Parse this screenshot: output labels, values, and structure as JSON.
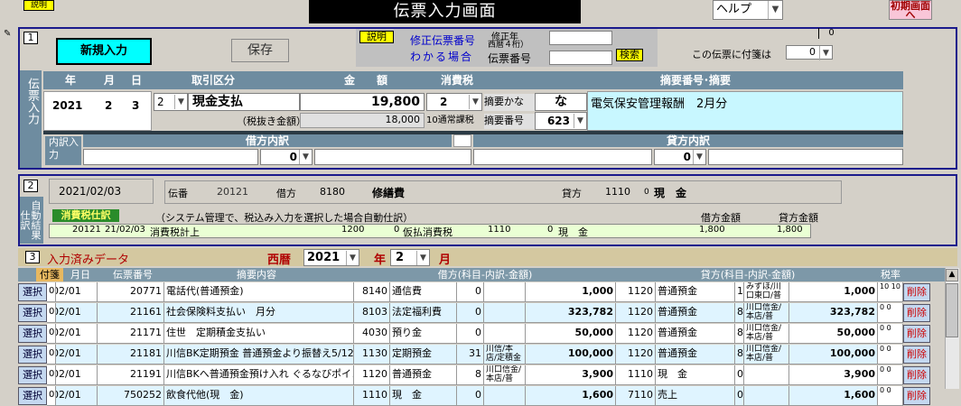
{
  "window": {
    "title": "伝票入力画面",
    "help_small": "説明",
    "help_combo": "ヘルプ",
    "init_button": "初期画面へ"
  },
  "section1": {
    "number": "1",
    "side_label": "伝票入力",
    "new_button": "新規入力",
    "save_button": "保存",
    "explain_button": "説明",
    "fix_label_line1": "修正伝票番号",
    "fix_label_line2": "わかる場合",
    "fix_year_label": "修正年",
    "fix_year_sub": "西暦４桁）",
    "slip_no_label": "伝票番号",
    "search_button": "検索",
    "tag_label": "この伝票に付箋は",
    "tag_value": "0",
    "top_right_value": "0",
    "headers": {
      "year": "年",
      "month": "月",
      "day": "日",
      "kind": "取引区分",
      "amount": "金　　額",
      "tax": "消費税",
      "memo": "摘要番号･摘要"
    },
    "entry": {
      "year": "2021",
      "month": "2",
      "day": "3",
      "kind_code": "2",
      "kind_name": "現金支払",
      "amount": "19,800",
      "tax_code": "2",
      "net_label": "（税抜き金額）",
      "net_amount": "18,000",
      "tax_type": "10通常課税",
      "kana_label": "摘要かな",
      "kana_value": "な",
      "memo_no_label": "摘要番号",
      "memo_no": "623",
      "memo_text": "電気保安管理報酬　2月分"
    },
    "breakdown_label": "内訳入力",
    "debit_label": "借方内訳",
    "credit_label": "貸方内訳",
    "debit_value": "0",
    "credit_value": "0"
  },
  "section2": {
    "number": "2",
    "side_label": "自動結果仕訳",
    "date": "2021/02/03",
    "slip_label": "伝番",
    "slip_no": "20121",
    "debit_label": "借方",
    "debit_code": "8180",
    "debit_name": "修繕費",
    "credit_label": "貸方",
    "credit_code": "1110",
    "credit_sub": "0",
    "credit_name": "現　金",
    "tax_title": "消費税仕訳",
    "tax_note": "（システム管理で、税込み入力を選択した場合自動仕訳）",
    "debit_amount_label": "借方金額",
    "credit_amount_label": "貸方金額",
    "tax_row": {
      "slip": "20121",
      "date": "21/02/03",
      "memo": "消費税計上",
      "dcode": "1200",
      "dsub": "0",
      "dname": "仮払消費税",
      "ccode": "1110",
      "csub": "0",
      "cname": "現　金",
      "damount": "1,800",
      "camount": "1,800"
    }
  },
  "section3": {
    "number": "3",
    "title": "入力済みデータ",
    "era_label": "西暦",
    "year": "2021",
    "year_label": "年",
    "month": "2",
    "month_label": "月",
    "columns": {
      "tag": "付箋",
      "date": "月日",
      "slip": "伝票番号",
      "memo": "摘要内容",
      "debit": "借方(科目-内訳-金額)",
      "credit": "貸方(科目-内訳-金額)",
      "rate": "税率"
    },
    "select_label": "選択",
    "delete_label": "削除",
    "rows": [
      {
        "tag": "0",
        "date": "02/01",
        "slip": "20771",
        "memo": "電話代(普通預金)",
        "dcode": "8140",
        "dname": "通信費",
        "dsub": "0",
        "dsubname": "",
        "damount": "1,000",
        "ccode": "1120",
        "cname": "普通預金",
        "csub": "1",
        "csubname": "みずほ/川口東口/普",
        "camount": "1,000",
        "r1": "10",
        "r2": "10"
      },
      {
        "tag": "0",
        "date": "02/01",
        "slip": "21161",
        "memo": "社会保険料支払い　月分",
        "dcode": "8103",
        "dname": "法定福利費",
        "dsub": "0",
        "dsubname": "",
        "damount": "323,782",
        "ccode": "1120",
        "cname": "普通預金",
        "csub": "8",
        "csubname": "川口信金/本店/普",
        "camount": "323,782",
        "r1": "0",
        "r2": "0"
      },
      {
        "tag": "0",
        "date": "02/01",
        "slip": "21171",
        "memo": "住世　定期積金支払い",
        "dcode": "4030",
        "dname": "預り金",
        "dsub": "0",
        "dsubname": "",
        "damount": "50,000",
        "ccode": "1120",
        "cname": "普通預金",
        "csub": "8",
        "csubname": "川口信金/本店/普",
        "camount": "50,000",
        "r1": "0",
        "r2": "0"
      },
      {
        "tag": "0",
        "date": "02/01",
        "slip": "21181",
        "memo": "川信BK定期預金 普通預金より振替え5/12",
        "dcode": "1130",
        "dname": "定期預金",
        "dsub": "31",
        "dsubname": "川信/本店/定積金",
        "damount": "100,000",
        "ccode": "1120",
        "cname": "普通預金",
        "csub": "8",
        "csubname": "川口信金/本店/普",
        "camount": "100,000",
        "r1": "0",
        "r2": "0"
      },
      {
        "tag": "0",
        "date": "02/01",
        "slip": "21191",
        "memo": "川信BKへ普通預金預け入れ ぐるなびポイント",
        "dcode": "1120",
        "dname": "普通預金",
        "dsub": "8",
        "dsubname": "川口信金/本店/普",
        "damount": "3,900",
        "ccode": "1110",
        "cname": "現　金",
        "csub": "0",
        "csubname": "",
        "camount": "3,900",
        "r1": "0",
        "r2": "0"
      },
      {
        "tag": "0",
        "date": "02/01",
        "slip": "750252",
        "memo": "飲食代他(現　金)",
        "dcode": "1110",
        "dname": "現　金",
        "dsub": "0",
        "dsubname": "",
        "damount": "1,600",
        "ccode": "7110",
        "cname": "売上",
        "csub": "0",
        "csubname": "",
        "camount": "1,600",
        "r1": "0",
        "r2": "0"
      }
    ]
  }
}
